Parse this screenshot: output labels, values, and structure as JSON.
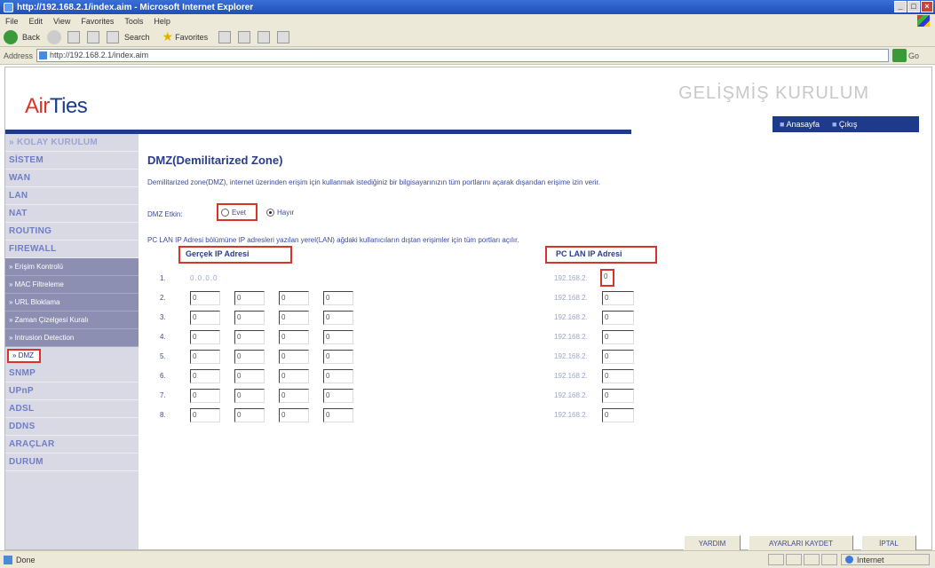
{
  "window": {
    "title": "http://192.168.2.1/index.aim - Microsoft Internet Explorer",
    "menu": [
      "File",
      "Edit",
      "View",
      "Favorites",
      "Tools",
      "Help"
    ],
    "toolbar": {
      "back": "Back",
      "search": "Search",
      "favorites": "Favorites"
    },
    "address_label": "Address",
    "address": "http://192.168.2.1/index.aim",
    "go": "Go",
    "status": "Done",
    "zone": "Internet"
  },
  "banner": {
    "logo_prefix": "Air",
    "logo_suffix": "Ties",
    "title": "GELİŞMİŞ KURULUM",
    "nav": [
      "Anasayfa",
      "Çıkış"
    ]
  },
  "sidebar": {
    "items": [
      {
        "label": "» KOLAY KURULUM",
        "kind": "top"
      },
      {
        "label": "SİSTEM",
        "kind": "item"
      },
      {
        "label": "WAN",
        "kind": "item"
      },
      {
        "label": "LAN",
        "kind": "item"
      },
      {
        "label": "NAT",
        "kind": "item"
      },
      {
        "label": "ROUTING",
        "kind": "item"
      },
      {
        "label": "FIREWALL",
        "kind": "item"
      },
      {
        "label": "» Erişim Kontrolü",
        "kind": "sub"
      },
      {
        "label": "» MAC Filtreleme",
        "kind": "sub"
      },
      {
        "label": "» URL Bloklama",
        "kind": "sub"
      },
      {
        "label": "» Zaman Çizelgesi Kuralı",
        "kind": "sub"
      },
      {
        "label": "» Intrusion Detection",
        "kind": "sub"
      },
      {
        "label": "» DMZ",
        "kind": "active"
      },
      {
        "label": "SNMP",
        "kind": "item"
      },
      {
        "label": "UPnP",
        "kind": "item"
      },
      {
        "label": "ADSL",
        "kind": "item"
      },
      {
        "label": "DDNS",
        "kind": "item"
      },
      {
        "label": "ARAÇLAR",
        "kind": "item"
      },
      {
        "label": "DURUM",
        "kind": "item"
      }
    ]
  },
  "main": {
    "title": "DMZ(Demilitarized Zone)",
    "description": "Demilitarized zone(DMZ), internet üzerinden erişim için kullanmak istediğiniz bir bilgisayarınızın tüm portlarını açarak dışarıdan erişime izin verir.",
    "enable_label": "DMZ Etkin:",
    "radio_yes": "Evet",
    "radio_no": "Hayır",
    "selected": "Hayır",
    "note": "PC LAN IP Adresi bölümüne IP adresleri yazılan yerel(LAN) ağdaki kullanıcıların dıştan erişimler için tüm portları açılır.",
    "col_real_ip": "Gerçek IP Adresi",
    "col_lan_ip": "PC LAN IP Adresi",
    "lan_prefix": "192.168.2.",
    "rows": [
      {
        "num": "1.",
        "static": "0.0.0.0",
        "octets": [],
        "lan": "0"
      },
      {
        "num": "2.",
        "octets": [
          "0",
          "0",
          "0",
          "0"
        ],
        "lan": "0"
      },
      {
        "num": "3.",
        "octets": [
          "0",
          "0",
          "0",
          "0"
        ],
        "lan": "0"
      },
      {
        "num": "4.",
        "octets": [
          "0",
          "0",
          "0",
          "0"
        ],
        "lan": "0"
      },
      {
        "num": "5.",
        "octets": [
          "0",
          "0",
          "0",
          "0"
        ],
        "lan": "0"
      },
      {
        "num": "6.",
        "octets": [
          "0",
          "0",
          "0",
          "0"
        ],
        "lan": "0"
      },
      {
        "num": "7.",
        "octets": [
          "0",
          "0",
          "0",
          "0"
        ],
        "lan": "0"
      },
      {
        "num": "8.",
        "octets": [
          "0",
          "0",
          "0",
          "0"
        ],
        "lan": "0"
      }
    ],
    "buttons": {
      "help": "YARDIM",
      "save": "AYARLARI KAYDET",
      "cancel": "İPTAL"
    }
  }
}
